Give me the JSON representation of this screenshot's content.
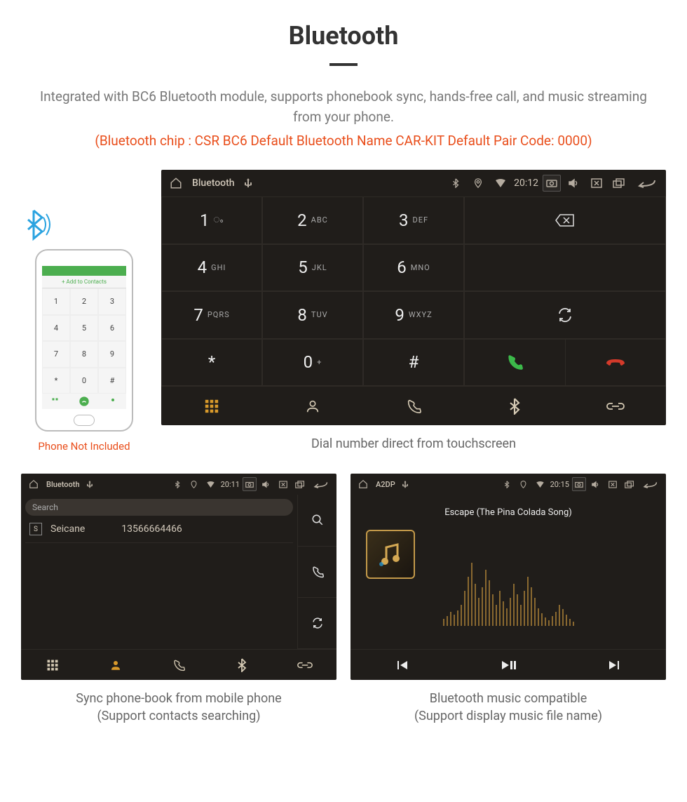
{
  "header": {
    "title": "Bluetooth",
    "intro": "Integrated with BC6 Bluetooth module, supports phonebook sync, hands-free call, and music streaming from your phone.",
    "specs": "(Bluetooth chip : CSR BC6     Default Bluetooth Name CAR-KIT     Default Pair Code: 0000)"
  },
  "phone_mock": {
    "add_label": "+  Add to Contacts",
    "keys": [
      "1",
      "2",
      "3",
      "4",
      "5",
      "6",
      "7",
      "8",
      "9",
      "*",
      "0",
      "#"
    ],
    "caption": "Phone Not Included"
  },
  "dialer": {
    "status": {
      "title": "Bluetooth",
      "time": "20:12"
    },
    "keys": [
      {
        "num": "1",
        "let": "ം"
      },
      {
        "num": "2",
        "let": "ABC"
      },
      {
        "num": "3",
        "let": "DEF"
      },
      {
        "num": "4",
        "let": "GHI"
      },
      {
        "num": "5",
        "let": "JKL"
      },
      {
        "num": "6",
        "let": "MNO"
      },
      {
        "num": "7",
        "let": "PQRS"
      },
      {
        "num": "8",
        "let": "TUV"
      },
      {
        "num": "9",
        "let": "WXYZ"
      },
      {
        "num": "*",
        "let": ""
      },
      {
        "num": "0",
        "let": "+"
      },
      {
        "num": "#",
        "let": ""
      }
    ],
    "caption": "Dial number direct from touchscreen"
  },
  "contacts": {
    "status": {
      "title": "Bluetooth",
      "time": "20:11"
    },
    "search_placeholder": "Search",
    "entries": [
      {
        "initial": "S",
        "name": "Seicane",
        "number": "13566664466"
      }
    ],
    "caption_line1": "Sync phone-book from mobile phone",
    "caption_line2": "(Support contacts searching)"
  },
  "music": {
    "status": {
      "title": "A2DP",
      "time": "20:15"
    },
    "track": "Escape (The Pina Colada Song)",
    "caption_line1": "Bluetooth music compatible",
    "caption_line2": "(Support display music file name)"
  }
}
